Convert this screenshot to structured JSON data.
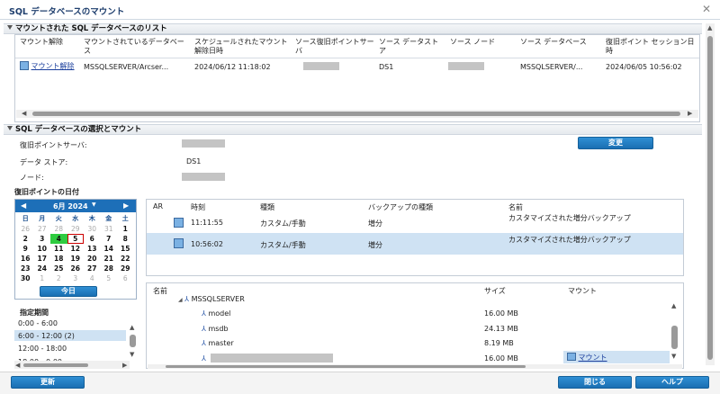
{
  "dialog": {
    "title": "SQL データベースのマウント",
    "close_glyph": "✕"
  },
  "mounted_section": {
    "heading": "マウントされた SQL データベースのリスト",
    "columns": [
      "マウント解除",
      "マウントされているデータベース",
      "スケジュールされたマウント解除日時",
      "ソース復旧ポイントサーバ",
      "ソース データストア",
      "ソース ノード",
      "ソース データベース",
      "復旧ポイント セッション日時"
    ],
    "row": {
      "unmount_link": "マウント解除",
      "database": "MSSQLSERVER/Arcser...",
      "scheduled": "2024/06/12 11:18:02",
      "datastore": "DS1",
      "source_db": "MSSQLSERVER/...",
      "session_time": "2024/06/05 10:56:02"
    }
  },
  "select_section": {
    "heading": "SQL データベースの選択とマウント",
    "rps_label": "復旧ポイントサーバ:",
    "datastore_label": "データ ストア:",
    "datastore_value": "DS1",
    "node_label": "ノード:",
    "change_button": "変更"
  },
  "recovery_date": {
    "heading": "復旧ポイントの日付",
    "month_label": "6月 2024",
    "weekdays": [
      "日",
      "月",
      "火",
      "水",
      "木",
      "金",
      "土"
    ],
    "weeks": [
      [
        "26",
        "27",
        "28",
        "29",
        "30",
        "31",
        "1"
      ],
      [
        "2",
        "3",
        "4",
        "5",
        "6",
        "7",
        "8"
      ],
      [
        "9",
        "10",
        "11",
        "12",
        "13",
        "14",
        "15"
      ],
      [
        "16",
        "17",
        "18",
        "19",
        "20",
        "21",
        "22"
      ],
      [
        "23",
        "24",
        "25",
        "26",
        "27",
        "28",
        "29"
      ],
      [
        "30",
        "1",
        "2",
        "3",
        "4",
        "5",
        "6"
      ]
    ],
    "today_button": "今日",
    "period_heading": "指定期間",
    "periods": [
      "0:00 - 6:00",
      "6:00 - 12:00  (2)",
      "12:00 - 18:00",
      "18:00 - 0:00"
    ]
  },
  "recovery_points": {
    "columns": [
      "AR",
      "時刻",
      "種類",
      "バックアップの種類",
      "名前"
    ],
    "rows": [
      {
        "time": "11:11:55",
        "type": "カスタム/手動",
        "backup_type": "増分",
        "name": "カスタマイズされた増分バックアップ"
      },
      {
        "time": "10:56:02",
        "type": "カスタム/手動",
        "backup_type": "増分",
        "name": "カスタマイズされた増分バックアップ"
      }
    ]
  },
  "databases": {
    "columns": [
      "名前",
      "サイズ",
      "マウント"
    ],
    "root": "MSSQLSERVER",
    "items": [
      {
        "name": "model",
        "size": "16.00 MB"
      },
      {
        "name": "msdb",
        "size": "24.13 MB"
      },
      {
        "name": "master",
        "size": "8.19 MB"
      },
      {
        "name": "",
        "size": "16.00 MB",
        "mount_link": "マウント"
      }
    ]
  },
  "footer": {
    "refresh": "更新",
    "close": "閉じる",
    "help": "ヘルプ"
  },
  "colors": {
    "accent": "#1d6fb8",
    "selected_row": "#cfe2f3",
    "today_green": "#2ecc40"
  }
}
